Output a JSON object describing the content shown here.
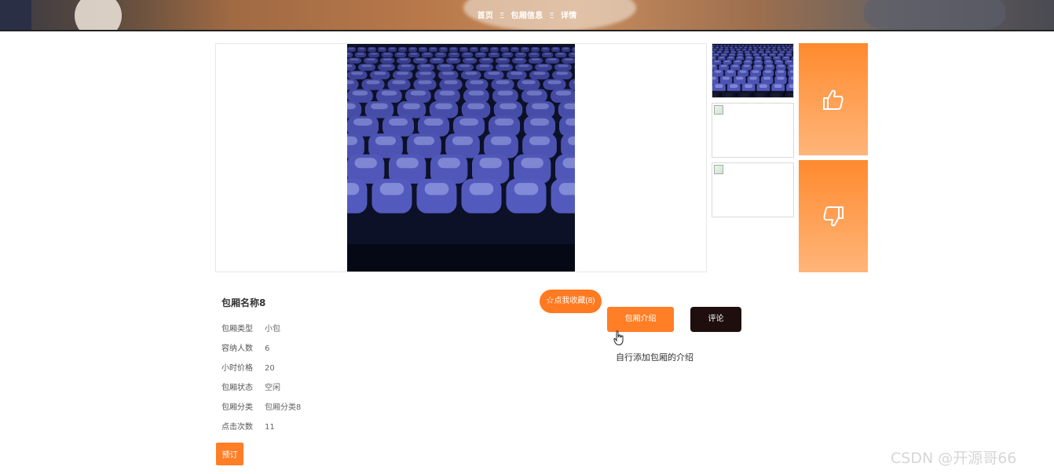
{
  "breadcrumb": {
    "home": "首页",
    "separator": "Ξ",
    "section": "包厢信息",
    "current": "详情"
  },
  "images": {
    "main_alt": "theater-seats-photo",
    "thumbnails": [
      "theater-seats-photo",
      "broken-image",
      "broken-image"
    ]
  },
  "vote": {
    "up_icon": "thumbs-up-icon",
    "down_icon": "thumbs-down-icon"
  },
  "room": {
    "name": "包厢名称8",
    "attributes": [
      {
        "label": "包厢类型",
        "value": "小包"
      },
      {
        "label": "容纳人数",
        "value": "6"
      },
      {
        "label": "小时价格",
        "value": "20"
      },
      {
        "label": "包厢状态",
        "value": "空闲"
      },
      {
        "label": "包厢分类",
        "value": "包厢分类8"
      },
      {
        "label": "点击次数",
        "value": "11"
      }
    ]
  },
  "actions": {
    "book": "预订",
    "favorite": "☆点我收藏(8)",
    "tab_intro": "包厢介绍",
    "tab_comment": "评论"
  },
  "intro_text": "自行添加包厢的介绍",
  "watermark": "CSDN @开源哥66",
  "colors": {
    "accent": "#ff7e26",
    "dark_button": "#1e0e0e"
  }
}
